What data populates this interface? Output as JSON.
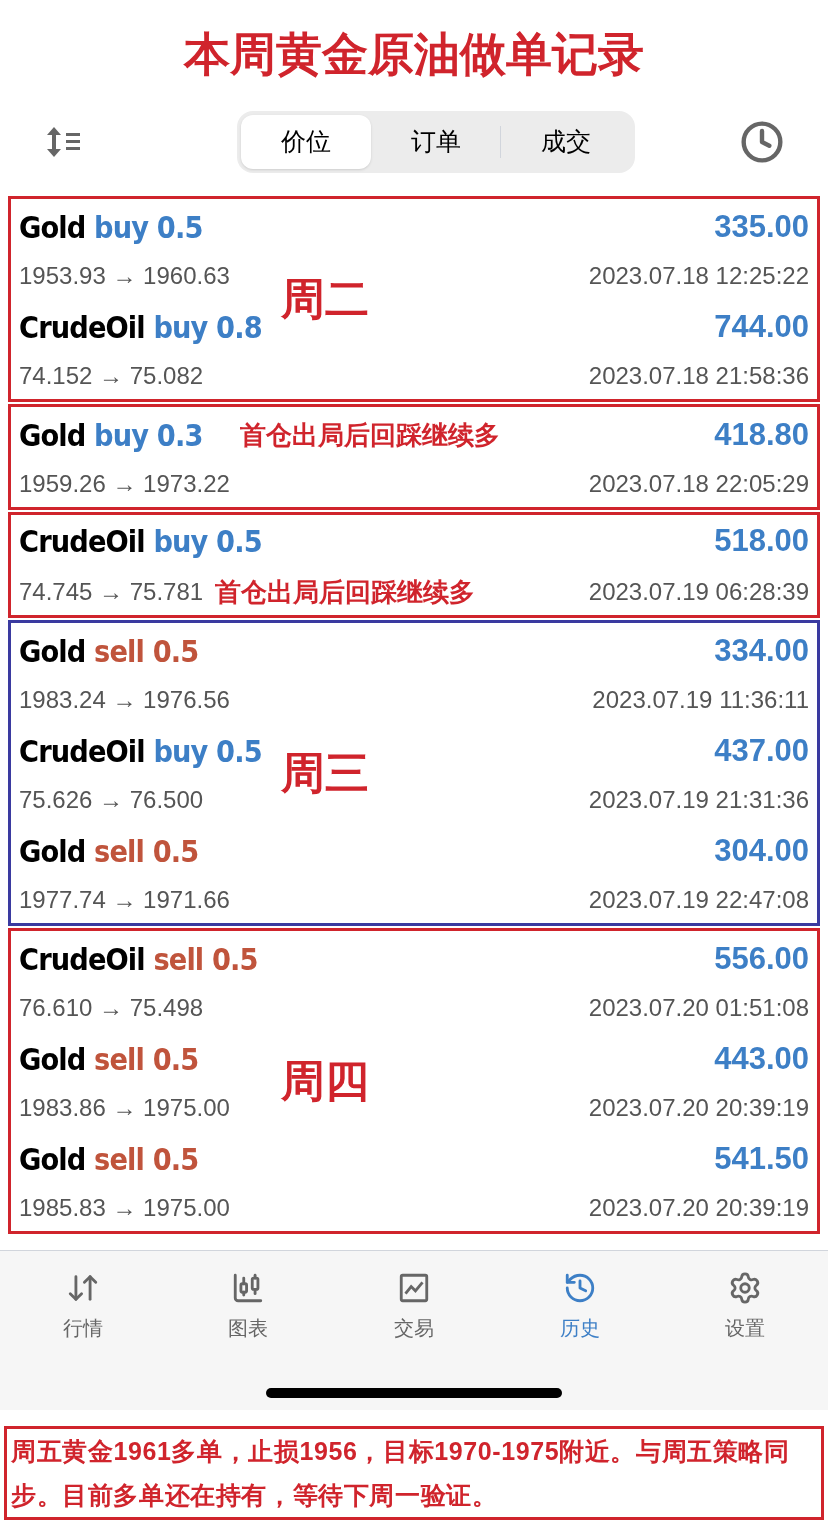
{
  "title": "本周黄金原油做单记录",
  "segments": [
    {
      "label": "价位",
      "selected": true
    },
    {
      "label": "订单",
      "selected": false
    },
    {
      "label": "成交",
      "selected": false
    }
  ],
  "groups": [
    {
      "color": "#d0242c",
      "week": "周二",
      "rows": [
        {
          "symbol": "Gold",
          "side": "buy",
          "kind": "buy",
          "volume": "0.5",
          "profit": "335.00",
          "prices": "1953.93 → 1960.63",
          "time": "2023.07.18 12:25:22"
        },
        {
          "symbol": "CrudeOil",
          "side": "buy",
          "kind": "buy",
          "volume": "0.8",
          "profit": "744.00",
          "prices": "74.152 → 75.082",
          "time": "2023.07.18 21:58:36"
        }
      ]
    },
    {
      "color": "#d0242c",
      "rows": [
        {
          "symbol": "Gold",
          "side": "buy",
          "kind": "buy",
          "volume": "0.3",
          "profit": "418.80",
          "prices": "1959.26 → 1973.22",
          "time": "2023.07.18 22:05:29",
          "note": {
            "text": "首仓出局后回踩继续多",
            "kind": "title"
          }
        }
      ]
    },
    {
      "color": "#d0242c",
      "rows": [
        {
          "symbol": "CrudeOil",
          "side": "buy",
          "kind": "buy",
          "volume": "0.5",
          "profit": "518.00",
          "prices": "74.745 → 75.781",
          "time": "2023.07.19 06:28:39",
          "note": {
            "text": "首仓出局后回踩继续多",
            "kind": "prices"
          }
        }
      ]
    },
    {
      "color": "#3a3aa0",
      "week": "周三",
      "rows": [
        {
          "symbol": "Gold",
          "side": "sell",
          "kind": "sell",
          "volume": "0.5",
          "profit": "334.00",
          "prices": "1983.24 → 1976.56",
          "time": "2023.07.19 11:36:11"
        },
        {
          "symbol": "CrudeOil",
          "side": "buy",
          "kind": "buy",
          "volume": "0.5",
          "profit": "437.00",
          "prices": "75.626 → 76.500",
          "time": "2023.07.19 21:31:36"
        },
        {
          "symbol": "Gold",
          "side": "sell",
          "kind": "sell",
          "volume": "0.5",
          "profit": "304.00",
          "prices": "1977.74 → 1971.66",
          "time": "2023.07.19 22:47:08"
        }
      ]
    },
    {
      "color": "#d0242c",
      "week": "周四",
      "rows": [
        {
          "symbol": "CrudeOil",
          "side": "sell",
          "kind": "sell",
          "volume": "0.5",
          "profit": "556.00",
          "prices": "76.610 → 75.498",
          "time": "2023.07.20 01:51:08"
        },
        {
          "symbol": "Gold",
          "side": "sell",
          "kind": "sell",
          "volume": "0.5",
          "profit": "443.00",
          "prices": "1983.86 → 1975.00",
          "time": "2023.07.20 20:39:19"
        },
        {
          "symbol": "Gold",
          "side": "sell",
          "kind": "sell",
          "volume": "0.5",
          "profit": "541.50",
          "prices": "1985.83 → 1975.00",
          "time": "2023.07.20 20:39:19"
        }
      ]
    }
  ],
  "nav": [
    {
      "label": "行情",
      "kind": "quotes",
      "selected": false
    },
    {
      "label": "图表",
      "kind": "chart",
      "selected": false
    },
    {
      "label": "交易",
      "kind": "trade",
      "selected": false
    },
    {
      "label": "历史",
      "kind": "history",
      "selected": true
    },
    {
      "label": "设置",
      "kind": "settings",
      "selected": false
    }
  ],
  "note": "周五黄金1961多单，止损1956，目标1970-1975附近。与周五策略同步。目前多单还在持有，等待下周一验证。"
}
